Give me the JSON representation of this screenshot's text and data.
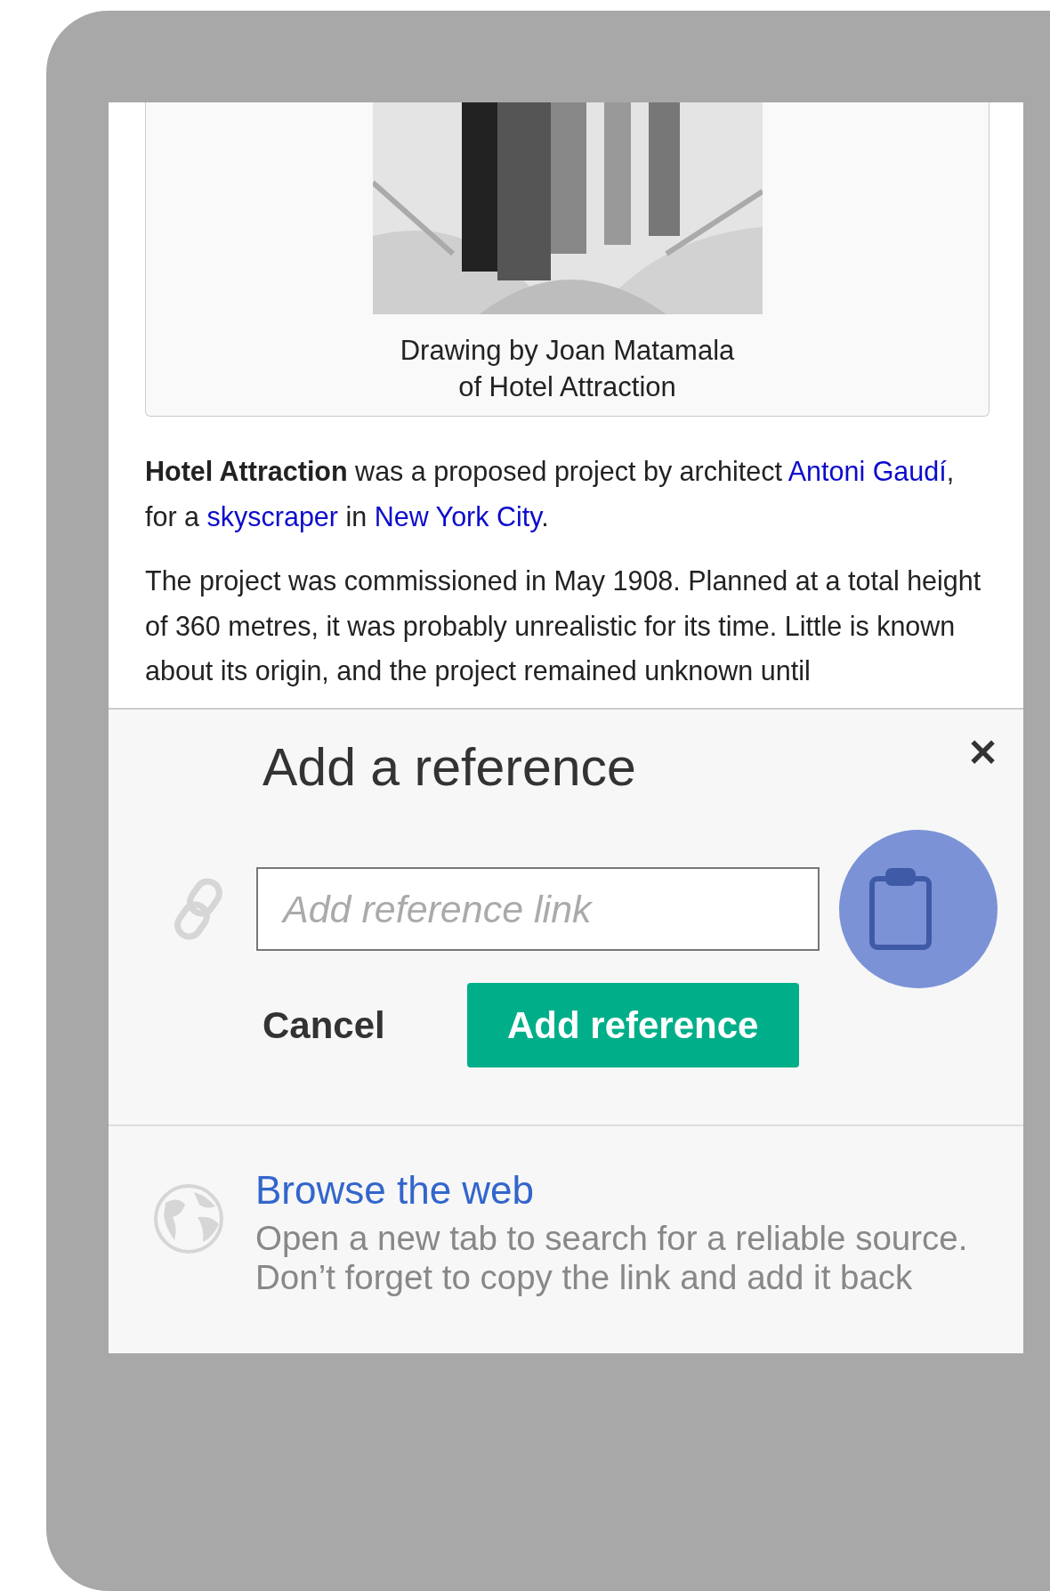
{
  "article": {
    "figure": {
      "caption": [
        "Drawing by Joan Matamala",
        "of Hotel Attraction"
      ]
    },
    "paragraphs": [
      [
        {
          "kind": "text",
          "text": "**Hotel Attraction** was a proposed project by architect "
        },
        {
          "kind": "link",
          "text": "Antoni Gaudí"
        },
        {
          "kind": "text",
          "text": ", for a "
        },
        {
          "kind": "link",
          "text": "skyscraper"
        },
        {
          "kind": "text",
          "text": " in "
        },
        {
          "kind": "link",
          "text": "New York City"
        },
        {
          "kind": "text",
          "text": "."
        }
      ],
      [
        {
          "kind": "text",
          "text": "The project was commissioned in May 1908. Planned at a total height of 360 metres, it was probably unrealistic for its time. Little is known about its origin, and the project remained unknown until"
        }
      ]
    ]
  },
  "dialog": {
    "title": "Add a reference",
    "close": "✕",
    "link_field": {
      "placeholder": "Add reference link"
    },
    "buttons": [
      {
        "label": "Cancel",
        "kind": "plain"
      },
      {
        "label": "Add reference",
        "kind": "primary"
      }
    ],
    "browse": {
      "title": "Browse the web",
      "description": [
        "Open a new tab to search for a reliable source.",
        "Don’t forget to copy the link and add it back"
      ]
    }
  }
}
